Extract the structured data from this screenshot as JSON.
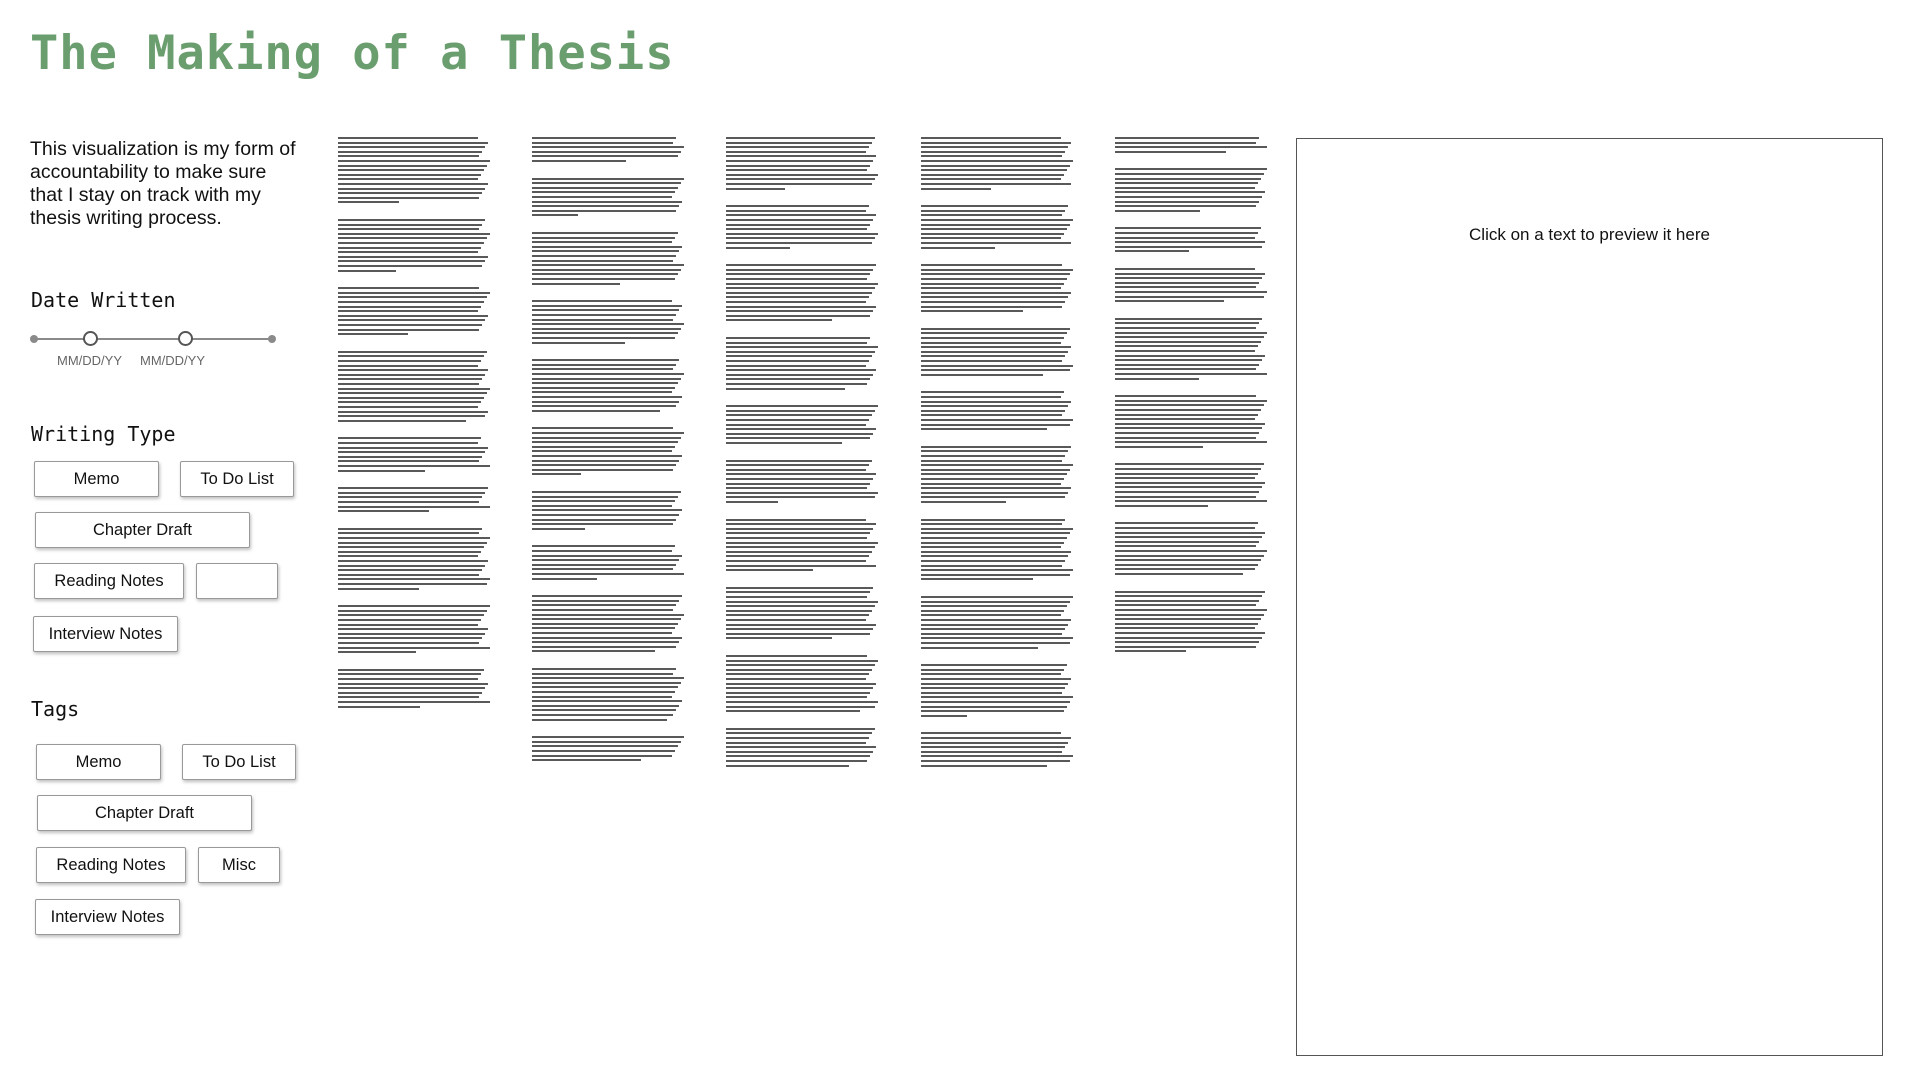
{
  "title": "The Making of a Thesis",
  "intro": "This visualization is my form of accountability to make sure that I stay on track with my thesis writing process.",
  "date_filter": {
    "heading": "Date Written",
    "start_label": "MM/DD/YY",
    "end_label": "MM/DD/YY"
  },
  "writing_type": {
    "heading": "Writing Type",
    "options": [
      "Memo",
      "To Do List",
      "Chapter Draft",
      "Reading Notes",
      "",
      "Interview Notes"
    ]
  },
  "tags": {
    "heading": "Tags",
    "options": [
      "Memo",
      "To Do List",
      "Chapter Draft",
      "Reading Notes",
      "Misc",
      "Interview Notes"
    ]
  },
  "preview": {
    "hint": "Click on a text to preview it here"
  },
  "documents": {
    "columns": [
      [
        15,
        12,
        11,
        16,
        8,
        6,
        14,
        11,
        9
      ],
      [
        6,
        9,
        12,
        10,
        12,
        11,
        9,
        8,
        13,
        12,
        6
      ],
      [
        12,
        10,
        13,
        12,
        9,
        10,
        12,
        12,
        13,
        9
      ],
      [
        12,
        10,
        11,
        11,
        9,
        13,
        14,
        12,
        12,
        8
      ],
      [
        4,
        10,
        6,
        8,
        14,
        12,
        10,
        12,
        14
      ]
    ]
  }
}
